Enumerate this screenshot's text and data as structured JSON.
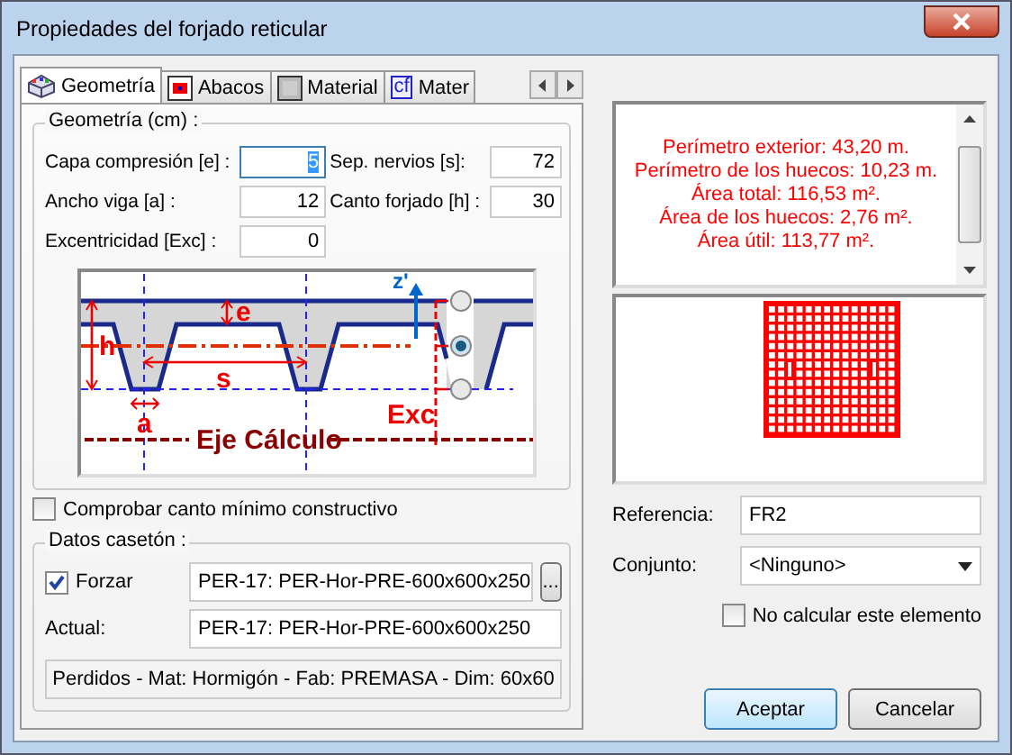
{
  "window": {
    "title": "Propiedades del forjado reticular"
  },
  "tabs": [
    {
      "label": "Geometría",
      "selected": true,
      "kind": "geometry"
    },
    {
      "label": "Abacos",
      "selected": false,
      "kind": "abacus"
    },
    {
      "label": "Material",
      "selected": false,
      "kind": "material"
    },
    {
      "label": "Mater",
      "selected": false,
      "kind": "cf",
      "icon_text": "cf"
    }
  ],
  "geometry": {
    "title": "Geometría (cm) :",
    "fields": [
      {
        "label": "Capa compresión [e] :",
        "value": "5",
        "focused": true
      },
      {
        "label": "Sep. nervios [s]:",
        "value": "72",
        "focused": false
      },
      {
        "label": "Ancho viga [a] :",
        "value": "12",
        "focused": false
      },
      {
        "label": "Canto forjado [h] :",
        "value": "30",
        "focused": false
      },
      {
        "label": "Excentricidad [Exc] :",
        "value": "0",
        "focused": false
      }
    ]
  },
  "diagram": {
    "z_label": "z'",
    "e_label": "e",
    "h_label": "h",
    "s_label": "s",
    "a_label": "a",
    "exc_label": "Exc",
    "axis_label": "Eje Cálculo",
    "radios": [
      {
        "selected": false
      },
      {
        "selected": true
      },
      {
        "selected": false
      }
    ]
  },
  "check_min": {
    "label": "Comprobar canto mínimo constructivo",
    "checked": false
  },
  "caseton": {
    "title": "Datos casetón :",
    "force": {
      "label": "Forzar",
      "checked": true,
      "value": "PER-17: PER-Hor-PRE-600x600x250",
      "button": "..."
    },
    "current": {
      "label": "Actual:",
      "value": "PER-17: PER-Hor-PRE-600x600x250"
    },
    "summary": "Perdidos - Mat: Hormigón - Fab: PREMASA - Dim: 60x60"
  },
  "info": {
    "lines": [
      "Perímetro exterior: 43,20 m.",
      "Perímetro de los huecos: 10,23 m.",
      "Área total: 116,53 m².",
      "Área de los huecos: 2,76 m².",
      "Área útil: 113,77 m²."
    ]
  },
  "reference": {
    "label": "Referencia:",
    "value": "FR2"
  },
  "group": {
    "label": "Conjunto:",
    "value": "<Ninguno>"
  },
  "no_calc": {
    "label": "No calcular este elemento",
    "checked": false
  },
  "buttons": [
    {
      "label": "Aceptar",
      "default": true
    },
    {
      "label": "Cancelar",
      "default": false
    }
  ]
}
